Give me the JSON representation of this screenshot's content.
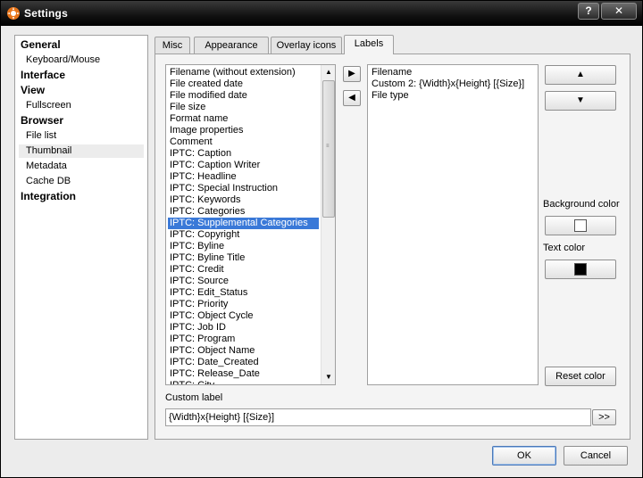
{
  "window": {
    "title": "Settings",
    "help_label": "?",
    "close_label": "✕"
  },
  "nav": [
    {
      "label": "General",
      "kind": "group"
    },
    {
      "label": "Keyboard/Mouse",
      "kind": "sub"
    },
    {
      "label": "Interface",
      "kind": "group"
    },
    {
      "label": "View",
      "kind": "group"
    },
    {
      "label": "Fullscreen",
      "kind": "sub"
    },
    {
      "label": "Browser",
      "kind": "group"
    },
    {
      "label": "File list",
      "kind": "sub"
    },
    {
      "label": "Thumbnail",
      "kind": "sub",
      "selected": true
    },
    {
      "label": "Metadata",
      "kind": "sub"
    },
    {
      "label": "Cache DB",
      "kind": "sub"
    },
    {
      "label": "Integration",
      "kind": "group"
    }
  ],
  "tabs": [
    {
      "label": "Misc"
    },
    {
      "label": "Appearance"
    },
    {
      "label": "Overlay icons"
    },
    {
      "label": "Labels",
      "active": true
    }
  ],
  "available_fields": [
    "Filename (without extension)",
    "File created date",
    "File modified date",
    "File size",
    "Format name",
    "Image properties",
    "Comment",
    "IPTC: Caption",
    "IPTC: Caption Writer",
    "IPTC: Headline",
    "IPTC: Special Instruction",
    "IPTC: Keywords",
    "IPTC: Categories",
    "IPTC: Supplemental Categories",
    "IPTC: Copyright",
    "IPTC: Byline",
    "IPTC: Byline Title",
    "IPTC: Credit",
    "IPTC: Source",
    "IPTC: Edit_Status",
    "IPTC: Priority",
    "IPTC: Object Cycle",
    "IPTC: Job ID",
    "IPTC: Program",
    "IPTC: Object Name",
    "IPTC: Date_Created",
    "IPTC: Release_Date",
    "IPTC: City"
  ],
  "available_selected_index": 13,
  "selected_fields": [
    "Filename",
    "Custom 2: {Width}x{Height} [{Size}]",
    "File type"
  ],
  "labels": {
    "background_color": "Background color",
    "text_color": "Text color",
    "reset_color": "Reset color",
    "custom_label": "Custom label",
    "apply_custom": ">>",
    "ok": "OK",
    "cancel": "Cancel"
  },
  "custom_label_value": "{Width}x{Height} [{Size}]",
  "colors": {
    "background_swatch": "#ffffff",
    "text_swatch": "#000000",
    "selection": "#3a79d8"
  },
  "icons": {
    "app": "xnview-icon",
    "add": "arrow-right-icon",
    "remove": "arrow-left-icon",
    "move_up": "arrow-up-icon",
    "move_down": "arrow-down-icon"
  }
}
